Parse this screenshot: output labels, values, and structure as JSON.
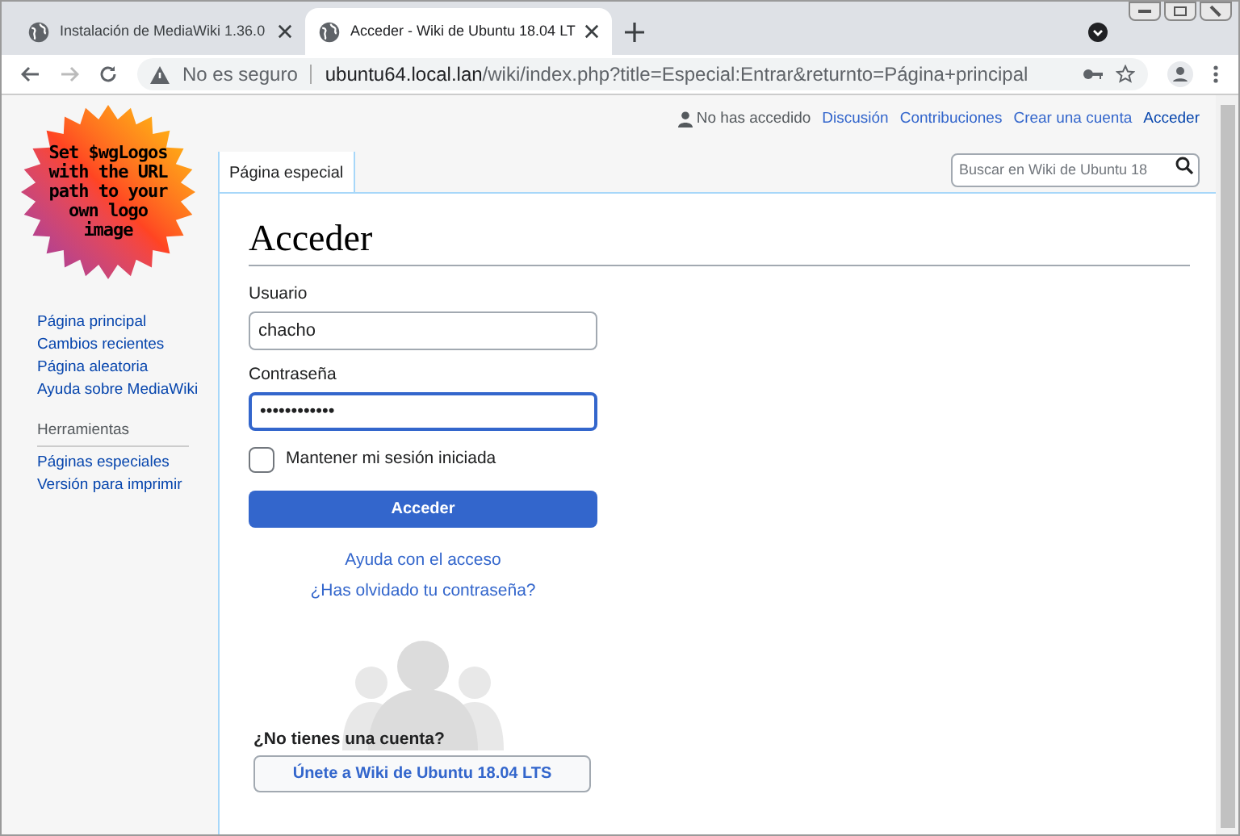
{
  "browser": {
    "tabs": [
      {
        "title": "Instalación de MediaWiki 1.36.0",
        "selected": false
      },
      {
        "title": "Acceder - Wiki de Ubuntu 18.04 LT",
        "selected": true
      }
    ],
    "security": "No es seguro",
    "url_host": "ubuntu64.local.lan",
    "url_path": "/wiki/index.php?title=Especial:Entrar&returnto=Página+principal"
  },
  "logo_text": "Set $wgLogos with the URL path to your own logo image",
  "sidebar": {
    "navigation": [
      "Página principal",
      "Cambios recientes",
      "Página aleatoria",
      "Ayuda sobre MediaWiki"
    ],
    "tools_heading": "Herramientas",
    "tools": [
      "Páginas especiales",
      "Versión para imprimir"
    ]
  },
  "personal": {
    "status": "No has accedido",
    "links": [
      "Discusión",
      "Contribuciones",
      "Crear una cuenta",
      "Acceder"
    ]
  },
  "tab": {
    "label": "Página especial"
  },
  "search": {
    "placeholder": "Buscar en Wiki de Ubuntu 18"
  },
  "heading": "Acceder",
  "form": {
    "fields": [
      {
        "label": "Usuario",
        "value": "chacho",
        "focused": false
      },
      {
        "label": "Contraseña",
        "value": "••••••••••••",
        "focused": true
      }
    ],
    "remember": {
      "label": "Mantener mi sesión iniciada",
      "checked": false
    },
    "submit": "Acceder",
    "links": [
      "Ayuda con el acceso",
      "¿Has olvidado tu contraseña?"
    ]
  },
  "signup": {
    "prompt": "¿No tienes una cuenta?",
    "button": "Únete a Wiki de Ubuntu 18.04 LTS"
  }
}
